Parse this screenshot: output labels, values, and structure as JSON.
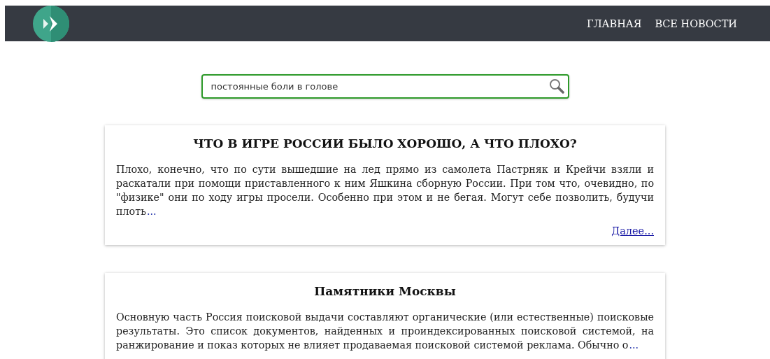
{
  "nav": {
    "items": [
      {
        "label": "ГЛАВНАЯ"
      },
      {
        "label": "ВСЕ НОВОСТИ"
      }
    ]
  },
  "search": {
    "value": "постоянные боли в голове"
  },
  "articles": [
    {
      "title": "ЧТО В ИГРЕ РОССИИ БЫЛО ХОРОШО, А ЧТО ПЛОХО?",
      "text": "Плохо, конечно, что по сути вышедшие на лед прямо из самолета Пастрняк и Крейчи взяли и раскатали при помощи приставленного к ним Яшкина сборную России. При том что, очевидно, по \"физике\" они по ходу игры просели. Особенно при этом и не бегая. Могут себе позволить, будучи плоть",
      "ellipsis": "...",
      "more": "Далее..."
    },
    {
      "title": "Памятники Москвы",
      "text": "Основную часть Россия поисковой выдачи составляют органические (или естественные) поисковые результаты. Это список документов, найденных и проиндексированных поисковой системой, на ранжирование и показ которых не влияет продаваемая поисковой системой реклама. Обычно о",
      "ellipsis": "..."
    }
  ]
}
